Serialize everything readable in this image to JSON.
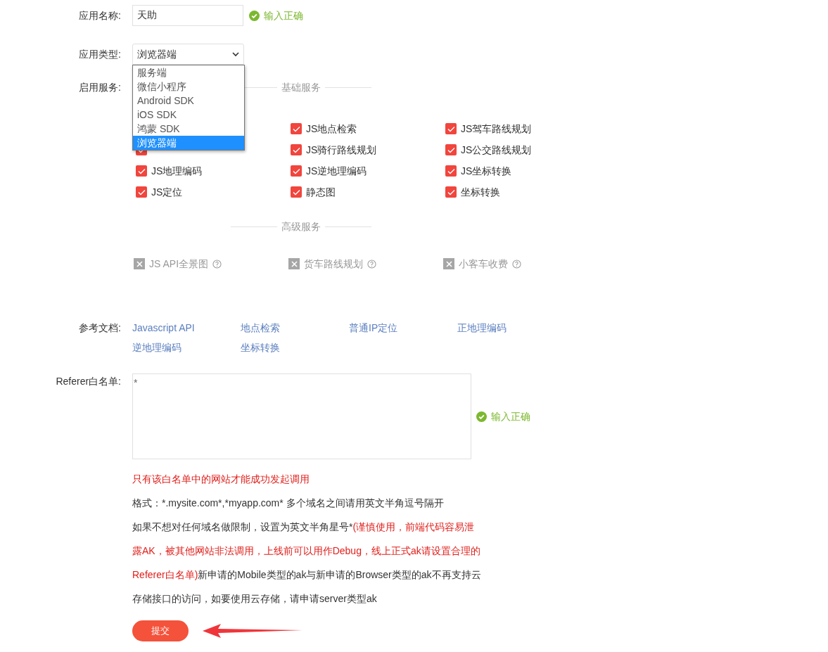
{
  "app_name": {
    "label": "应用名称:",
    "value": "天助",
    "validation": "输入正确"
  },
  "app_type": {
    "label": "应用类型:",
    "value": "浏览器端",
    "expanded": true,
    "options": [
      {
        "label": "服务端",
        "selected": false
      },
      {
        "label": "微信小程序",
        "selected": false
      },
      {
        "label": "Android SDK",
        "selected": false
      },
      {
        "label": "iOS SDK",
        "selected": false
      },
      {
        "label": "鸿蒙 SDK",
        "selected": false
      },
      {
        "label": "浏览器端",
        "selected": true
      }
    ]
  },
  "services": {
    "label": "启用服务:",
    "basic_title": "基础服务",
    "basic": [
      {
        "label": "JS地点检索",
        "checked": true
      },
      {
        "label": "JS驾车路线规划",
        "checked": true
      },
      {
        "checked": true
      },
      {
        "label": "JS骑行路线规划",
        "checked": true
      },
      {
        "label": "JS公交路线规划",
        "checked": true
      },
      {
        "label": "JS地理编码",
        "checked": true
      },
      {
        "label": "JS逆地理编码",
        "checked": true
      },
      {
        "label": "JS坐标转换",
        "checked": true
      },
      {
        "label": "JS定位",
        "checked": true
      },
      {
        "label": "静态图",
        "checked": true
      },
      {
        "label": "坐标转换",
        "checked": true
      }
    ],
    "advanced_title": "高级服务",
    "advanced": [
      {
        "label": "JS API全景图",
        "disabled": true
      },
      {
        "label": "货车路线规划",
        "disabled": true
      },
      {
        "label": "小客车收费",
        "disabled": true
      }
    ]
  },
  "docs": {
    "label": "参考文档:",
    "links": [
      "Javascript API",
      "地点检索",
      "普通IP定位",
      "正地理编码",
      "逆地理编码",
      "坐标转换"
    ]
  },
  "referer": {
    "label": "Referer白名单:",
    "value": "*",
    "validation": "输入正确"
  },
  "notes": [
    {
      "segments": [
        {
          "kind": "warning",
          "text": "只有该白名单中的网站才能成功发起调用"
        }
      ]
    },
    {
      "segments": [
        {
          "kind": "normal",
          "text": "格式：*.mysite.com*,*myapp.com* 多个域名之间请用英文半角逗号隔开"
        }
      ]
    },
    {
      "segments": [
        {
          "kind": "normal",
          "text": "如果不想对任何域名做限制，设置为英文半角星号*"
        },
        {
          "kind": "warning",
          "text": "(谨慎使用，前端代码容易泄露AK，被其他网站非法调用，上线前可以用作Debug，线上正式ak请设置合理的Referer白名单)"
        },
        {
          "kind": "normal",
          "text": "新申请的Mobile类型的ak与新申请的Browser类型的ak不再支持云存储接口的访问，如要使用云存储，请申请server类型ak"
        }
      ]
    }
  ],
  "submit": "提交"
}
